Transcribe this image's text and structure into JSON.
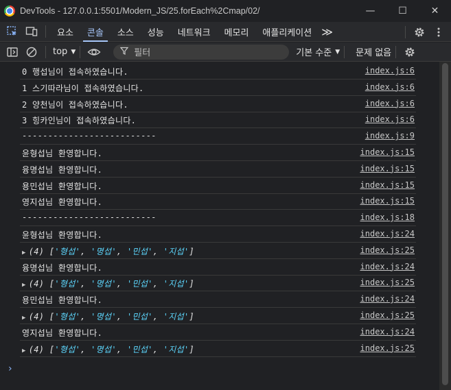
{
  "window": {
    "app_name": "DevTools",
    "title": "DevTools - 127.0.0.1:5501/Modern_JS/25.forEach%2Cmap/02/",
    "minimize": "—",
    "maximize": "☐",
    "close": "✕"
  },
  "tabs": [
    {
      "label": "요소"
    },
    {
      "label": "콘솔"
    },
    {
      "label": "소스"
    },
    {
      "label": "성능"
    },
    {
      "label": "네트워크"
    },
    {
      "label": "메모리"
    },
    {
      "label": "애플리케이션"
    }
  ],
  "tabs_more": "≫",
  "toolbar": {
    "context": "top",
    "filter_placeholder": "필터",
    "levels": "기본 수준",
    "issues": "문제 없음"
  },
  "console": {
    "rows": [
      {
        "text": "0 행섭님이 접속하였습니다.",
        "source": "index.js:6"
      },
      {
        "text": "1 스기따라님이 접속하였습니다.",
        "source": "index.js:6"
      },
      {
        "text": "2 양천님이 접속하였습니다.",
        "source": "index.js:6"
      },
      {
        "text": "3 힝카인님이 접속하였습니다.",
        "source": "index.js:6"
      },
      {
        "text": "--------------------------",
        "source": "index.js:9"
      },
      {
        "text": "윤형섭님 환영합니다.",
        "source": "index.js:15"
      },
      {
        "text": "융명섭님 환영합니다.",
        "source": "index.js:15"
      },
      {
        "text": "용민섭님 환영합니다.",
        "source": "index.js:15"
      },
      {
        "text": "영지섭님 환영합니다.",
        "source": "index.js:15"
      },
      {
        "text": "--------------------------",
        "source": "index.js:18"
      },
      {
        "text": "윤형섭님 환영합니다.",
        "source": "index.js:24"
      },
      {
        "array": true,
        "count": "(4)",
        "items": [
          "'형섭'",
          "'명섭'",
          "'민섭'",
          "'지섭'"
        ],
        "source": "index.js:25"
      },
      {
        "text": "융명섭님 환영합니다.",
        "source": "index.js:24"
      },
      {
        "array": true,
        "count": "(4)",
        "items": [
          "'형섭'",
          "'명섭'",
          "'민섭'",
          "'지섭'"
        ],
        "source": "index.js:25"
      },
      {
        "text": "용민섭님 환영합니다.",
        "source": "index.js:24"
      },
      {
        "array": true,
        "count": "(4)",
        "items": [
          "'형섭'",
          "'명섭'",
          "'민섭'",
          "'지섭'"
        ],
        "source": "index.js:25"
      },
      {
        "text": "영지섭님 환영합니다.",
        "source": "index.js:24"
      },
      {
        "array": true,
        "count": "(4)",
        "items": [
          "'형섭'",
          "'명섭'",
          "'민섭'",
          "'지섭'"
        ],
        "source": "index.js:25"
      }
    ],
    "prompt": "›"
  },
  "colors": {
    "accent": "#a8c7fa",
    "string": "#5cd5fb",
    "background": "#202124"
  }
}
